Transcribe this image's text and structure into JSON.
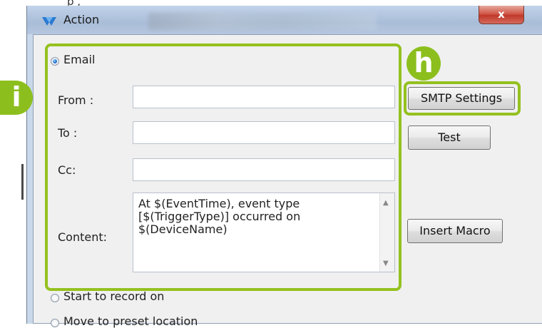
{
  "top_caption": "p                              ,",
  "window": {
    "title": "Action",
    "close_symbol": "x"
  },
  "email_group": {
    "email_label": "Email",
    "email_selected": true,
    "from_label": "From :",
    "from_value": "",
    "to_label": "To :",
    "to_value": "",
    "cc_label": "Cc:",
    "cc_value": "",
    "content_label": "Content:",
    "content_value": "At $(EventTime), event type\n[$(TriggerType)] occurred on\n$(DeviceName)"
  },
  "buttons": {
    "smtp_settings": "SMTP Settings",
    "test": "Test",
    "insert_macro": "Insert Macro"
  },
  "other_options": {
    "record_label": "Start to record on",
    "preset_label": "Move to preset location"
  },
  "annotations": {
    "badge_h": "h",
    "badge_i": "i",
    "highlight_color": "#94c11f"
  }
}
